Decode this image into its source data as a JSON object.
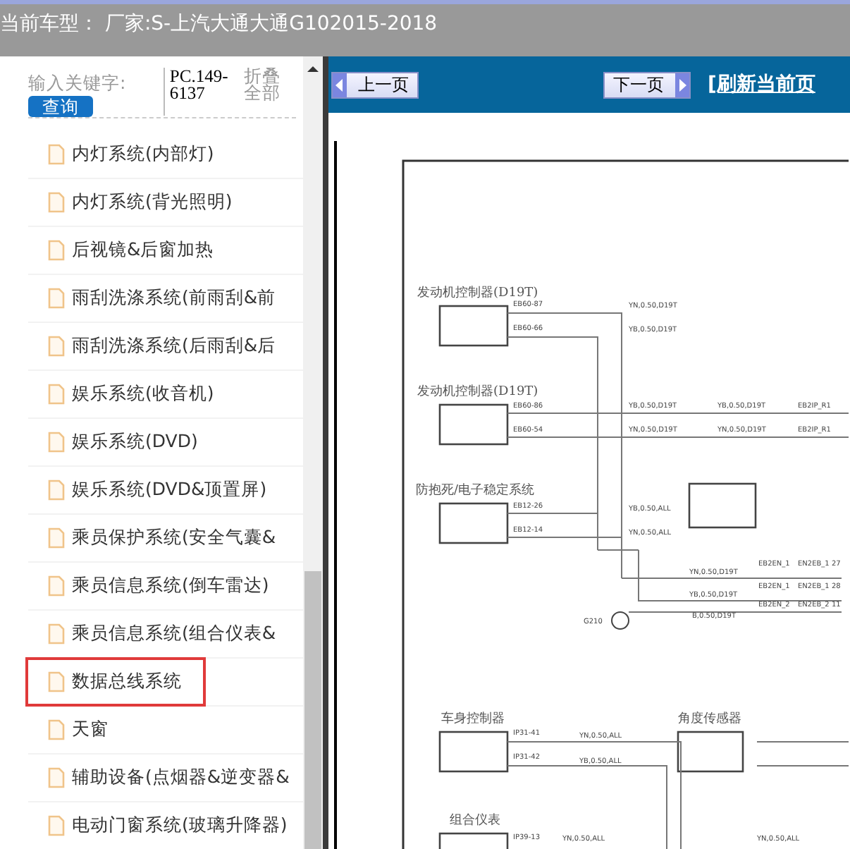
{
  "header": {
    "title": "当前车型： 厂家:S-上汽大通大通G102015-2018"
  },
  "sidebar": {
    "search": {
      "label": "输入关键字:",
      "button": "查询",
      "code": "PC.149-6137",
      "collapse": "折叠全部"
    },
    "items": [
      {
        "label": "内灯系统(内部灯)",
        "selected": false
      },
      {
        "label": "内灯系统(背光照明)",
        "selected": false
      },
      {
        "label": "后视镜&后窗加热",
        "selected": false
      },
      {
        "label": "雨刮洗涤系统(前雨刮&前",
        "selected": false
      },
      {
        "label": "雨刮洗涤系统(后雨刮&后",
        "selected": false
      },
      {
        "label": "娱乐系统(收音机)",
        "selected": false
      },
      {
        "label": "娱乐系统(DVD)",
        "selected": false
      },
      {
        "label": "娱乐系统(DVD&顶置屏)",
        "selected": false
      },
      {
        "label": "乘员保护系统(安全气囊&",
        "selected": false
      },
      {
        "label": "乘员信息系统(倒车雷达)",
        "selected": false
      },
      {
        "label": "乘员信息系统(组合仪表&",
        "selected": false
      },
      {
        "label": "数据总线系统",
        "selected": true
      },
      {
        "label": "天窗",
        "selected": false
      },
      {
        "label": "辅助设备(点烟器&逆变器&",
        "selected": false
      },
      {
        "label": "电动门窗系统(玻璃升降器)",
        "selected": false
      }
    ]
  },
  "viewer": {
    "prev": "上一页",
    "next": "下一页",
    "refresh": "[刷新当前页",
    "diagram": {
      "modules": [
        "发动机控制器(D19T)",
        "发动机控制器(D19T)",
        "防抱死/电子稳定系统",
        "车身控制器",
        "角度传感器",
        "组合仪表"
      ],
      "labels": [
        "EB60-87",
        "EB60-66",
        "YN,0.50,D19T",
        "YB,0.50,D19T",
        "EB60-86",
        "EB60-54",
        "YB,0.50,D19T",
        "YN,0.50,D19T",
        "YB,0.50,D19T",
        "YN,0.50,D19T",
        "EB2IP_R1",
        "EB2IP_R1",
        "EB12-26",
        "YB,0.50,ALL",
        "EB12-14",
        "YN,0.50,ALL",
        "YN,0.50,D19T",
        "YB,0.50,D19T",
        "EB2EN_1",
        "EN2EB_1 27",
        "EB2EN_1",
        "EN2EB_1 28",
        "EB2EN_2",
        "EN2EB_2 11",
        "G210",
        "B,0.50,D19T",
        "IP31-41",
        "YN,0.50,ALL",
        "IP31-42",
        "YB,0.50,ALL",
        "IP39-13",
        "YN,0.50,ALL",
        "YN,0.50,ALL"
      ]
    }
  }
}
